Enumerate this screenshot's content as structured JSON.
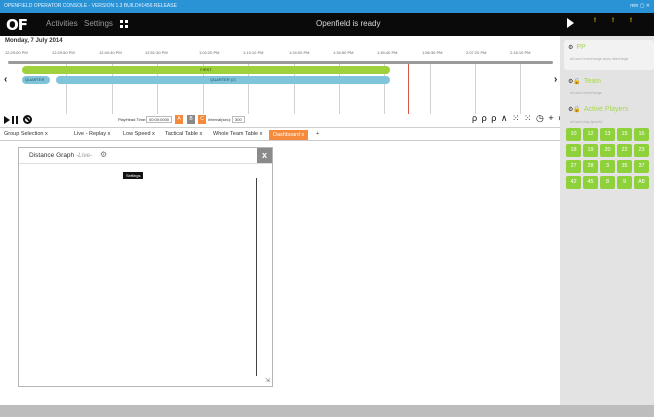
{
  "titlebar": {
    "text": "OPENFIELD OPERATOR CONSOLE - VERSION 1.3 BUILD#1456 RELEASE",
    "winbtns": "min  ▢  ✕"
  },
  "topbar": {
    "logo": "OF",
    "nav": [
      "Activities",
      "Settings"
    ],
    "status": "Openfield is ready"
  },
  "timeline": {
    "date": "Monday, 7 July 2014",
    "times": [
      "12:29:00 PM",
      "12:29:50 PM",
      "12:40:40 PM",
      "12:51:30 PM",
      "1:02:20 PM",
      "1:13:10 PM",
      "1:24:00 PM",
      "1:34:50 PM",
      "1:45:40 PM",
      "1:56:30 PM",
      "2:07:20 PM",
      "2:18:10 PM"
    ],
    "bar_first": "FIRST",
    "bar_q1": "QUARTER",
    "bar_q2": "QUARTER (2)"
  },
  "controls": {
    "playhead_label": "PlayHead Time:",
    "playhead_value": "00:00:0000",
    "btn_a": "A",
    "btn_b": "B",
    "btn_c": "C",
    "interval_label": "Interval(sec):",
    "interval_value": "300",
    "tools": "ρ ρ ρ ∧ ⁙ ⁙ ◷ + ⊘"
  },
  "tabs": [
    {
      "label": "Group Selection  x"
    },
    {
      "label": "Live - Replay  x"
    },
    {
      "label": "Low Speed  x"
    },
    {
      "label": "Tactical Table  x"
    },
    {
      "label": "Whole Team Table  x"
    },
    {
      "label": "Dashboard  x"
    },
    {
      "label": "+"
    }
  ],
  "panel": {
    "title": "Distance Graph",
    "live": "-Live-",
    "tooltip": "Settings",
    "close": "x"
  },
  "rightpanel": {
    "pp": {
      "title": "PP",
      "sub": "all  none  invert/range  show  hide/range"
    },
    "team": {
      "title": "Team",
      "sub": "all  none  invert/range"
    },
    "players": {
      "title": "Active Players",
      "sub": "all  none  play  ignored"
    },
    "numbers": [
      "10",
      "12",
      "13",
      "15",
      "16",
      "18",
      "19",
      "20",
      "22",
      "23",
      "27",
      "28",
      "3",
      "35",
      "37",
      "42",
      "45",
      "8",
      "9",
      "A8"
    ]
  },
  "colors": {
    "accent_green": "#8ed13a",
    "tab_active": "#f58a3c",
    "titlebar": "#2a93d5"
  }
}
